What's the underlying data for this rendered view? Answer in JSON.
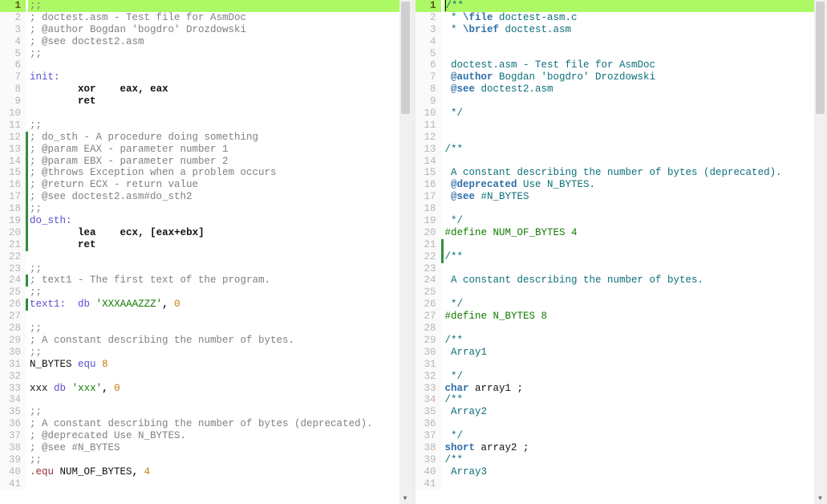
{
  "left": {
    "activeLine": 1,
    "lines": [
      {
        "n": 1,
        "cb": 0,
        "tokens": [
          {
            "t": ";;",
            "c": "c-comment"
          }
        ],
        "active": true
      },
      {
        "n": 2,
        "cb": 0,
        "tokens": [
          {
            "t": "; doctest.asm - Test file for AsmDoc",
            "c": "c-comment"
          }
        ]
      },
      {
        "n": 3,
        "cb": 0,
        "tokens": [
          {
            "t": "; @author Bogdan 'bogdro' Drozdowski",
            "c": "c-comment"
          }
        ]
      },
      {
        "n": 4,
        "cb": 0,
        "tokens": [
          {
            "t": "; @see doctest2.asm",
            "c": "c-comment"
          }
        ]
      },
      {
        "n": 5,
        "cb": 0,
        "tokens": [
          {
            "t": ";;",
            "c": "c-comment"
          }
        ]
      },
      {
        "n": 6,
        "cb": 0,
        "tokens": []
      },
      {
        "n": 7,
        "cb": 0,
        "tokens": [
          {
            "t": "init:",
            "c": "c-label"
          }
        ]
      },
      {
        "n": 8,
        "cb": 0,
        "tokens": [
          {
            "t": "        ",
            "c": ""
          },
          {
            "t": "xor",
            "c": "c-mnem"
          },
          {
            "t": "    ",
            "c": ""
          },
          {
            "t": "eax",
            "c": "c-reg"
          },
          {
            "t": ", ",
            "c": "c-punct"
          },
          {
            "t": "eax",
            "c": "c-reg"
          }
        ]
      },
      {
        "n": 9,
        "cb": 0,
        "tokens": [
          {
            "t": "        ",
            "c": ""
          },
          {
            "t": "ret",
            "c": "c-mnem"
          }
        ]
      },
      {
        "n": 10,
        "cb": 0,
        "tokens": []
      },
      {
        "n": 11,
        "cb": 0,
        "tokens": [
          {
            "t": ";;",
            "c": "c-comment"
          }
        ]
      },
      {
        "n": 12,
        "cb": 1,
        "tokens": [
          {
            "t": "; do_sth - A procedure doing something",
            "c": "c-comment"
          }
        ]
      },
      {
        "n": 13,
        "cb": 1,
        "tokens": [
          {
            "t": "; @param EAX - parameter number 1",
            "c": "c-comment"
          }
        ]
      },
      {
        "n": 14,
        "cb": 1,
        "tokens": [
          {
            "t": "; @param EBX - parameter number 2",
            "c": "c-comment"
          }
        ]
      },
      {
        "n": 15,
        "cb": 1,
        "tokens": [
          {
            "t": "; @throws Exception when a problem occurs",
            "c": "c-comment"
          }
        ]
      },
      {
        "n": 16,
        "cb": 1,
        "tokens": [
          {
            "t": "; @return ECX - return value",
            "c": "c-comment"
          }
        ]
      },
      {
        "n": 17,
        "cb": 1,
        "tokens": [
          {
            "t": "; @see doctest2.asm#do_sth2",
            "c": "c-comment"
          }
        ]
      },
      {
        "n": 18,
        "cb": 1,
        "tokens": [
          {
            "t": ";;",
            "c": "c-comment"
          }
        ]
      },
      {
        "n": 19,
        "cb": 1,
        "tokens": [
          {
            "t": "do_sth:",
            "c": "c-label"
          }
        ]
      },
      {
        "n": 20,
        "cb": 1,
        "tokens": [
          {
            "t": "        ",
            "c": ""
          },
          {
            "t": "lea",
            "c": "c-mnem"
          },
          {
            "t": "    ",
            "c": ""
          },
          {
            "t": "ecx",
            "c": "c-reg"
          },
          {
            "t": ", [",
            "c": "c-punct"
          },
          {
            "t": "eax",
            "c": "c-reg"
          },
          {
            "t": "+",
            "c": "c-punct"
          },
          {
            "t": "ebx",
            "c": "c-reg"
          },
          {
            "t": "]",
            "c": "c-punct"
          }
        ]
      },
      {
        "n": 21,
        "cb": 1,
        "tokens": [
          {
            "t": "        ",
            "c": ""
          },
          {
            "t": "ret",
            "c": "c-mnem"
          }
        ]
      },
      {
        "n": 22,
        "cb": 0,
        "tokens": []
      },
      {
        "n": 23,
        "cb": 0,
        "tokens": [
          {
            "t": ";;",
            "c": "c-comment"
          }
        ]
      },
      {
        "n": 24,
        "cb": 1,
        "tokens": [
          {
            "t": "; text1 - The first text of the program.",
            "c": "c-comment"
          }
        ]
      },
      {
        "n": 25,
        "cb": 0,
        "tokens": [
          {
            "t": ";;",
            "c": "c-comment"
          }
        ]
      },
      {
        "n": 26,
        "cb": 1,
        "tokens": [
          {
            "t": "text1:",
            "c": "c-label"
          },
          {
            "t": "  ",
            "c": ""
          },
          {
            "t": "db",
            "c": "c-pseudo"
          },
          {
            "t": " ",
            "c": ""
          },
          {
            "t": "'XXXAAAZZZ'",
            "c": "c-str"
          },
          {
            "t": ", ",
            "c": "c-punct"
          },
          {
            "t": "0",
            "c": "c-num"
          }
        ]
      },
      {
        "n": 27,
        "cb": 0,
        "tokens": []
      },
      {
        "n": 28,
        "cb": 0,
        "tokens": [
          {
            "t": ";;",
            "c": "c-comment"
          }
        ]
      },
      {
        "n": 29,
        "cb": 0,
        "tokens": [
          {
            "t": "; A constant describing the number of bytes.",
            "c": "c-comment"
          }
        ]
      },
      {
        "n": 30,
        "cb": 0,
        "tokens": [
          {
            "t": ";;",
            "c": "c-comment"
          }
        ]
      },
      {
        "n": 31,
        "cb": 0,
        "tokens": [
          {
            "t": "N_BYTES",
            "c": "c-ident"
          },
          {
            "t": " ",
            "c": ""
          },
          {
            "t": "equ",
            "c": "c-pseudo"
          },
          {
            "t": " ",
            "c": ""
          },
          {
            "t": "8",
            "c": "c-num"
          }
        ]
      },
      {
        "n": 32,
        "cb": 0,
        "tokens": []
      },
      {
        "n": 33,
        "cb": 0,
        "tokens": [
          {
            "t": "xxx",
            "c": "c-ident"
          },
          {
            "t": " ",
            "c": ""
          },
          {
            "t": "db",
            "c": "c-pseudo"
          },
          {
            "t": " ",
            "c": ""
          },
          {
            "t": "'xxx'",
            "c": "c-str"
          },
          {
            "t": ", ",
            "c": "c-punct"
          },
          {
            "t": "0",
            "c": "c-num"
          }
        ]
      },
      {
        "n": 34,
        "cb": 0,
        "tokens": []
      },
      {
        "n": 35,
        "cb": 0,
        "tokens": [
          {
            "t": ";;",
            "c": "c-comment"
          }
        ]
      },
      {
        "n": 36,
        "cb": 0,
        "tokens": [
          {
            "t": "; A constant describing the number of bytes (deprecated).",
            "c": "c-comment"
          }
        ]
      },
      {
        "n": 37,
        "cb": 0,
        "tokens": [
          {
            "t": "; @deprecated Use N_BYTES.",
            "c": "c-comment"
          }
        ]
      },
      {
        "n": 38,
        "cb": 0,
        "tokens": [
          {
            "t": "; @see #N_BYTES",
            "c": "c-comment"
          }
        ]
      },
      {
        "n": 39,
        "cb": 0,
        "tokens": [
          {
            "t": ";;",
            "c": "c-comment"
          }
        ]
      },
      {
        "n": 40,
        "cb": 0,
        "tokens": [
          {
            "t": ".equ",
            "c": "c-dot"
          },
          {
            "t": " ",
            "c": ""
          },
          {
            "t": "NUM_OF_BYTES",
            "c": "c-ident"
          },
          {
            "t": ", ",
            "c": "c-punct"
          },
          {
            "t": "4",
            "c": "c-num"
          }
        ]
      },
      {
        "n": 41,
        "cb": 0,
        "tokens": []
      }
    ]
  },
  "right": {
    "activeLine": 1,
    "lines": [
      {
        "n": 1,
        "cb": 0,
        "tokens": [
          {
            "t": "/**",
            "c": "c-dox"
          }
        ],
        "active": true,
        "cursor": true
      },
      {
        "n": 2,
        "cb": 0,
        "tokens": [
          {
            "t": " * ",
            "c": "c-dox"
          },
          {
            "t": "\\file",
            "c": "c-doxkey"
          },
          {
            "t": " doctest-asm.c",
            "c": "c-dox"
          }
        ]
      },
      {
        "n": 3,
        "cb": 0,
        "tokens": [
          {
            "t": " * ",
            "c": "c-dox"
          },
          {
            "t": "\\brief",
            "c": "c-doxkey"
          },
          {
            "t": " doctest.asm",
            "c": "c-dox"
          }
        ]
      },
      {
        "n": 4,
        "cb": 0,
        "tokens": []
      },
      {
        "n": 5,
        "cb": 0,
        "tokens": []
      },
      {
        "n": 6,
        "cb": 0,
        "tokens": [
          {
            "t": " doctest.asm - Test file for AsmDoc",
            "c": "c-dox"
          }
        ]
      },
      {
        "n": 7,
        "cb": 0,
        "tokens": [
          {
            "t": " ",
            "c": ""
          },
          {
            "t": "@author",
            "c": "c-doxkey"
          },
          {
            "t": " Bogdan 'bogdro' Drozdowski",
            "c": "c-dox"
          }
        ]
      },
      {
        "n": 8,
        "cb": 0,
        "tokens": [
          {
            "t": " ",
            "c": ""
          },
          {
            "t": "@see",
            "c": "c-doxkey"
          },
          {
            "t": " doctest2.asm",
            "c": "c-dox"
          }
        ]
      },
      {
        "n": 9,
        "cb": 0,
        "tokens": []
      },
      {
        "n": 10,
        "cb": 0,
        "tokens": [
          {
            "t": " */",
            "c": "c-dox"
          }
        ]
      },
      {
        "n": 11,
        "cb": 0,
        "tokens": []
      },
      {
        "n": 12,
        "cb": 0,
        "tokens": []
      },
      {
        "n": 13,
        "cb": 0,
        "tokens": [
          {
            "t": "/**",
            "c": "c-dox"
          }
        ]
      },
      {
        "n": 14,
        "cb": 0,
        "tokens": []
      },
      {
        "n": 15,
        "cb": 0,
        "tokens": [
          {
            "t": " A constant describing the number of bytes (deprecated).",
            "c": "c-dox"
          }
        ]
      },
      {
        "n": 16,
        "cb": 0,
        "tokens": [
          {
            "t": " ",
            "c": ""
          },
          {
            "t": "@deprecated",
            "c": "c-doxkey"
          },
          {
            "t": " Use N_BYTES.",
            "c": "c-dox"
          }
        ]
      },
      {
        "n": 17,
        "cb": 0,
        "tokens": [
          {
            "t": " ",
            "c": ""
          },
          {
            "t": "@see",
            "c": "c-doxkey"
          },
          {
            "t": " #N_BYTES",
            "c": "c-dox"
          }
        ]
      },
      {
        "n": 18,
        "cb": 0,
        "tokens": []
      },
      {
        "n": 19,
        "cb": 0,
        "tokens": [
          {
            "t": " */",
            "c": "c-dox"
          }
        ]
      },
      {
        "n": 20,
        "cb": 0,
        "tokens": [
          {
            "t": "#define NUM_OF_BYTES 4",
            "c": "c-macro"
          }
        ]
      },
      {
        "n": 21,
        "cb": 1,
        "tokens": []
      },
      {
        "n": 22,
        "cb": 1,
        "tokens": [
          {
            "t": "/**",
            "c": "c-dox"
          }
        ]
      },
      {
        "n": 23,
        "cb": 0,
        "tokens": []
      },
      {
        "n": 24,
        "cb": 0,
        "tokens": [
          {
            "t": " A constant describing the number of bytes.",
            "c": "c-dox"
          }
        ]
      },
      {
        "n": 25,
        "cb": 0,
        "tokens": []
      },
      {
        "n": 26,
        "cb": 0,
        "tokens": [
          {
            "t": " */",
            "c": "c-dox"
          }
        ]
      },
      {
        "n": 27,
        "cb": 0,
        "tokens": [
          {
            "t": "#define N_BYTES 8",
            "c": "c-macro"
          }
        ]
      },
      {
        "n": 28,
        "cb": 0,
        "tokens": []
      },
      {
        "n": 29,
        "cb": 0,
        "tokens": [
          {
            "t": "/**",
            "c": "c-dox"
          }
        ]
      },
      {
        "n": 30,
        "cb": 0,
        "tokens": [
          {
            "t": " Array1",
            "c": "c-dox"
          }
        ]
      },
      {
        "n": 31,
        "cb": 0,
        "tokens": []
      },
      {
        "n": 32,
        "cb": 0,
        "tokens": [
          {
            "t": " */",
            "c": "c-dox"
          }
        ]
      },
      {
        "n": 33,
        "cb": 0,
        "tokens": [
          {
            "t": "char",
            "c": "c-type"
          },
          {
            "t": " array1 ;",
            "c": "c-ident"
          }
        ]
      },
      {
        "n": 34,
        "cb": 0,
        "tokens": [
          {
            "t": "/**",
            "c": "c-dox"
          }
        ]
      },
      {
        "n": 35,
        "cb": 0,
        "tokens": [
          {
            "t": " Array2",
            "c": "c-dox"
          }
        ]
      },
      {
        "n": 36,
        "cb": 0,
        "tokens": []
      },
      {
        "n": 37,
        "cb": 0,
        "tokens": [
          {
            "t": " */",
            "c": "c-dox"
          }
        ]
      },
      {
        "n": 38,
        "cb": 0,
        "tokens": [
          {
            "t": "short",
            "c": "c-type"
          },
          {
            "t": " array2 ;",
            "c": "c-ident"
          }
        ]
      },
      {
        "n": 39,
        "cb": 0,
        "tokens": [
          {
            "t": "/**",
            "c": "c-dox"
          }
        ]
      },
      {
        "n": 40,
        "cb": 0,
        "tokens": [
          {
            "t": " Array3",
            "c": "c-dox"
          }
        ]
      },
      {
        "n": 41,
        "cb": 0,
        "tokens": []
      }
    ]
  }
}
